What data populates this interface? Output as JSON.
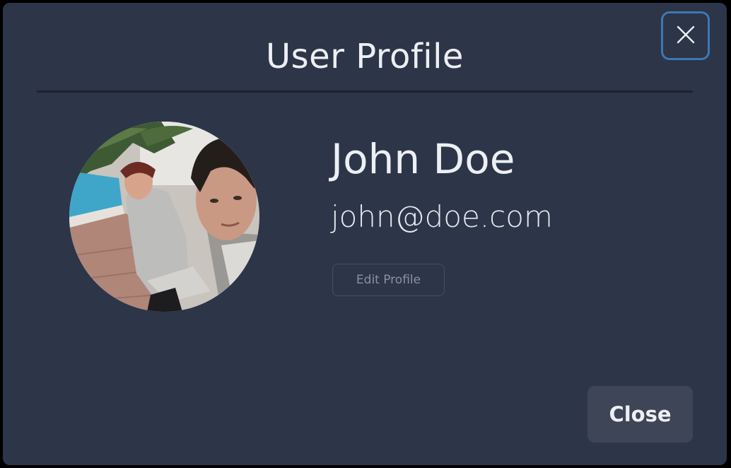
{
  "modal": {
    "title": "User Profile",
    "close_icon": "close-icon"
  },
  "profile": {
    "name": "John Doe",
    "email": "john@doe.com",
    "avatar_alt": "User avatar photo",
    "edit_label": "Edit Profile"
  },
  "footer": {
    "close_label": "Close"
  },
  "colors": {
    "modal_background": "#2d3548",
    "focus_ring": "#3d78b3",
    "close_button_background": "#3d4556",
    "text_primary": "#eceff4",
    "text_muted": "#8a91a0"
  }
}
